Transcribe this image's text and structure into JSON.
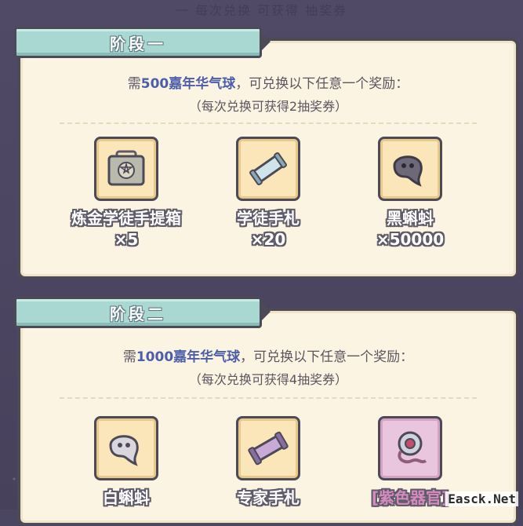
{
  "top_strip": "一 每次兑换 可获得 抽奖券",
  "stages": [
    {
      "title": "阶段一",
      "req_prefix": "需",
      "req_amount": "500嘉年华气球",
      "req_suffix": "，可兑换以下任意一个奖励：",
      "note": "（每次兑换可获得2抽奖券）",
      "items": [
        {
          "name": "炼金学徒手提箱",
          "qty": "×5",
          "icon": "briefcase-icon"
        },
        {
          "name": "学徒手札",
          "qty": "×20",
          "icon": "scroll-icon"
        },
        {
          "name": "黑蝌蚪",
          "qty": "×50000",
          "icon": "black-tadpole-icon"
        }
      ]
    },
    {
      "title": "阶段二",
      "req_prefix": "需",
      "req_amount": "1000嘉年华气球",
      "req_suffix": "，可兑换以下任意一个奖励：",
      "note": "（每次兑换可获得4抽奖券）",
      "items": [
        {
          "name": "白蝌蚪",
          "icon": "white-tadpole-icon"
        },
        {
          "name": "专家手札",
          "icon": "expert-scroll-icon"
        },
        {
          "name": "[紫色器官]",
          "icon": "purple-organ-icon"
        }
      ]
    }
  ],
  "watermark": "Easck.Net"
}
